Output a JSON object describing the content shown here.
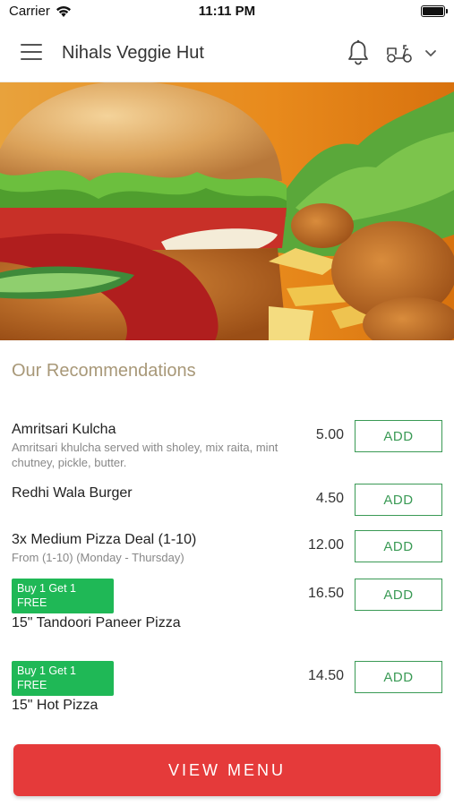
{
  "status_bar": {
    "carrier": "Carrier",
    "time": "11:11 PM",
    "icons": [
      "wifi-icon",
      "battery-icon"
    ]
  },
  "header": {
    "title": "Nihals Veggie Hut",
    "icons": [
      "menu-icon",
      "bell-icon",
      "scooter-icon",
      "chevron-down-icon"
    ]
  },
  "banner": {
    "description_icon": "food-banner-image"
  },
  "recommendations": {
    "title": "Our Recommendations",
    "add_label": "ADD",
    "items": [
      {
        "name": "Amritsari Kulcha",
        "description": "Amritsari khulcha served with sholey, mix raita, mint chutney, pickle, butter.",
        "price": "5.00",
        "badge": ""
      },
      {
        "name": "Redhi Wala Burger",
        "description": "",
        "price": "4.50",
        "badge": ""
      },
      {
        "name": "3x Medium Pizza Deal (1-10)",
        "description": "From (1-10) (Monday - Thursday)",
        "price": "12.00",
        "badge": ""
      },
      {
        "name": "15\" Tandoori Paneer Pizza",
        "description": "",
        "price": "16.50",
        "badge": "Buy 1 Get 1 FREE"
      },
      {
        "name": "15\" Hot Pizza",
        "description": "",
        "price": "14.50",
        "badge": "Buy 1 Get 1 FREE"
      }
    ]
  },
  "footer": {
    "view_menu_label": "VIEW MENU"
  },
  "colors": {
    "accent_green": "#3a9a55",
    "badge_green": "#1fb856",
    "view_menu_red": "#e53a3a",
    "section_title": "#a89878"
  }
}
